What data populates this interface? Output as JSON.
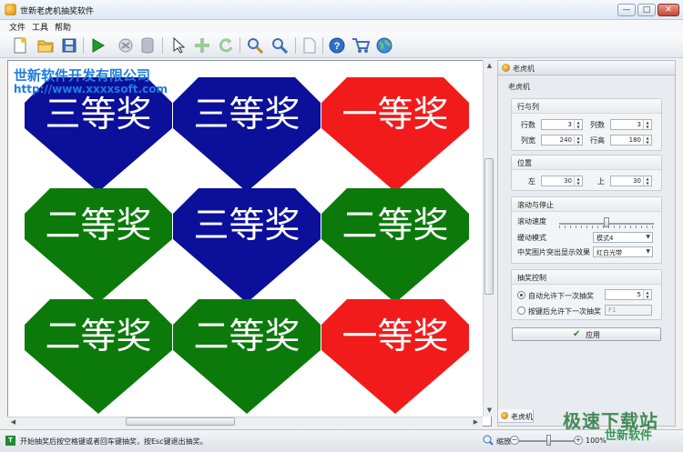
{
  "window": {
    "title": "世新老虎机抽奖软件",
    "minimize_glyph": "—",
    "maximize_glyph": "□",
    "close_glyph": "✕"
  },
  "menu": [
    "文件",
    "工具",
    "帮助"
  ],
  "toolbar": {
    "icons": [
      "new-file-icon",
      "open-folder-icon",
      "save-icon",
      "play-icon",
      "lottery-icon",
      "database-icon",
      "pointer-icon",
      "move-icon",
      "refresh-icon",
      "search-person-icon",
      "search-icon",
      "document-icon",
      "help-icon",
      "cart-icon",
      "globe-icon"
    ]
  },
  "canvas": {
    "watermark_title": "世新软件开发有限公司",
    "watermark_url": "http://www.xxxxsoft.com",
    "prizes": [
      {
        "label": "三等奖",
        "color": "#0b0f9a"
      },
      {
        "label": "三等奖",
        "color": "#0b0f9a"
      },
      {
        "label": "一等奖",
        "color": "#f21b1b"
      },
      {
        "label": "二等奖",
        "color": "#0b7a0b"
      },
      {
        "label": "三等奖",
        "color": "#0b0f9a"
      },
      {
        "label": "二等奖",
        "color": "#0b7a0b"
      },
      {
        "label": "二等奖",
        "color": "#0b7a0b"
      },
      {
        "label": "二等奖",
        "color": "#0b7a0b"
      },
      {
        "label": "一等奖",
        "color": "#f21b1b"
      }
    ]
  },
  "panel": {
    "header": "老虎机",
    "section_title": "老虎机",
    "rows_cols": {
      "title": "行与列",
      "rows_label": "行数",
      "rows_value": "3",
      "cols_label": "列数",
      "cols_value": "3",
      "col_width_label": "列宽",
      "col_width_value": "240",
      "row_height_label": "行高",
      "row_height_value": "180"
    },
    "position": {
      "title": "位置",
      "left_label": "左",
      "left_value": "30",
      "top_label": "上",
      "top_value": "30"
    },
    "scroll_stop": {
      "title": "滚动与停止",
      "speed_label": "滚动速度",
      "speed_level": 0.5,
      "easing_label": "缓动模式",
      "easing_value": "模式4",
      "highlight_label": "中奖图片突出显示效果",
      "highlight_value": "红白光带"
    },
    "control": {
      "title": "抽奖控制",
      "auto_label": "自动允许下一次抽奖",
      "auto_value": "5",
      "key_label": "按键后允许下一次抽奖",
      "key_value": "F1"
    },
    "apply_label": "应用",
    "bottom_tab": "老虎机"
  },
  "status": {
    "icon_letter": "T",
    "text": "开始抽奖后按空格键或者回车键抽奖，按Esc键退出抽奖。",
    "zoom_label": "缩放",
    "zoom_value": "100%"
  },
  "brand_watermark": "极速下载站",
  "brand_watermark_sub": "世新软件"
}
